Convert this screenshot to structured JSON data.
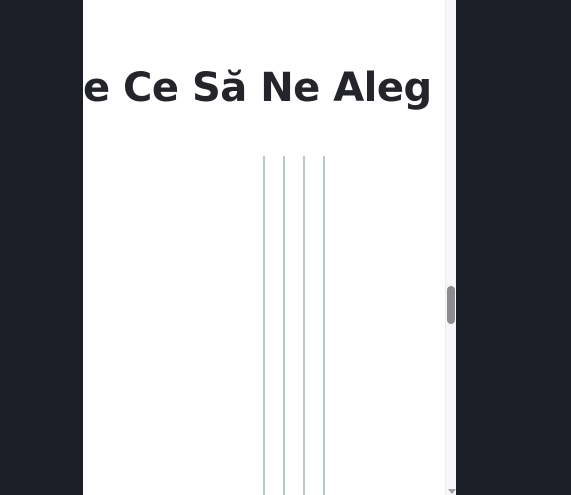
{
  "page": {
    "heading": "e Ce Să Ne Aleg"
  },
  "colors": {
    "backdrop": "#1b1e26",
    "page_background": "#ffffff",
    "heading_text": "#23252b",
    "divider_lines": "#b7c9c6",
    "scrollbar_thumb": "#8c8c8c"
  },
  "icons": {
    "scroll_down": "chevron-down-icon"
  }
}
